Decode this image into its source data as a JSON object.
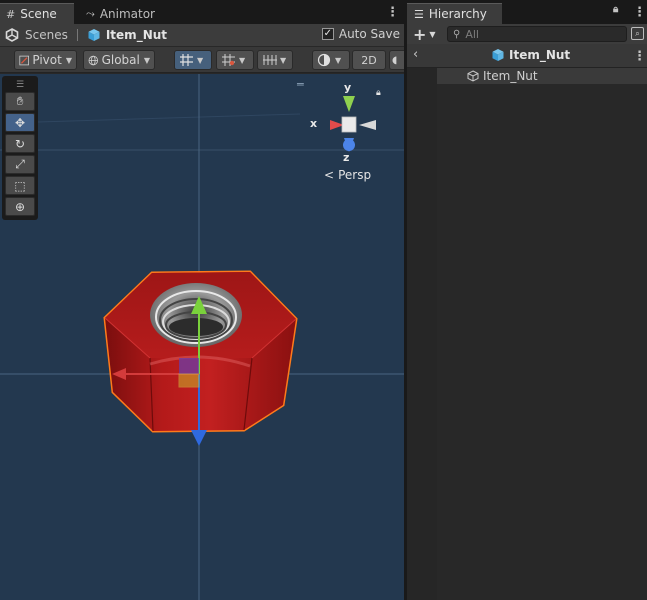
{
  "scene_tabs": {
    "scene_label": "Scene",
    "animator_label": "Animator"
  },
  "breadcrumb": {
    "scenes_label": "Scenes",
    "current_label": "Item_Nut"
  },
  "autosave": {
    "label": "Auto Save",
    "checked": true
  },
  "toolbar": {
    "pivot_label": "Pivot",
    "global_label": "Global",
    "mode_2d_label": "2D"
  },
  "gizmo": {
    "x_label": "x",
    "y_label": "y",
    "z_label": "z",
    "projection_label": "Persp"
  },
  "hierarchy": {
    "tab_label": "Hierarchy",
    "search_placeholder": "All",
    "header_label": "Item_Nut",
    "items": [
      {
        "label": "Item_Nut"
      }
    ]
  },
  "colors": {
    "viewport_bg": "#23384f",
    "selection_outline": "#ff7a1a",
    "nut_red": "#a51717",
    "axis_x": "#d33b3b",
    "axis_y": "#7ad13c",
    "axis_z": "#2f6ae0",
    "active_button": "#46607c"
  }
}
